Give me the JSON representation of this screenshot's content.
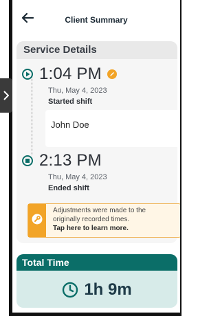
{
  "header": {
    "title": "Client Summary",
    "back_icon": "arrow-left-icon"
  },
  "service_details": {
    "title": "Service Details",
    "start": {
      "time": "1:04 PM",
      "date": "Thu, May 4, 2023",
      "status": "Started shift",
      "icon": "play-circle-icon",
      "badge_icon": "edit-badge-icon"
    },
    "note": "John Doe",
    "end": {
      "time": "2:13 PM",
      "date": "Thu, May 4, 2023",
      "status": "Ended shift",
      "icon": "stop-circle-icon"
    },
    "alert": {
      "line1": "Adjustments were made to the",
      "line2": "originally recorded times.",
      "line3": "Tap here to learn more.",
      "icon": "wrench-icon"
    }
  },
  "total": {
    "title": "Total Time",
    "value": "1h 9m",
    "icon": "clock-icon"
  },
  "colors": {
    "teal": "#0b6e68",
    "orange": "#f2a428",
    "dark_text": "#2b2f36",
    "light_teal_bg": "#d7ebe9"
  },
  "side_tab": {
    "icon": "chevron-right-icon"
  }
}
